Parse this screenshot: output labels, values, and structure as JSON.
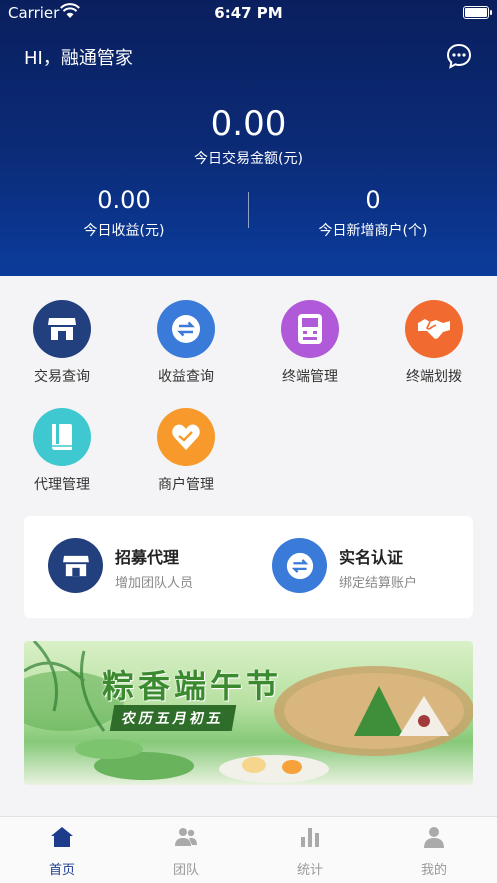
{
  "status_bar": {
    "carrier": "Carrier",
    "time": "6:47 PM"
  },
  "header": {
    "greeting": "HI，融通管家",
    "today_amount": "0.00",
    "today_amount_label": "今日交易金额(元)",
    "today_income": "0.00",
    "today_income_label": "今日收益(元)",
    "new_merchants": "0",
    "new_merchants_label": "今日新增商户(个)"
  },
  "menu": [
    {
      "label": "交易查询",
      "icon": "store-icon",
      "color": "#23407e"
    },
    {
      "label": "收益查询",
      "icon": "exchange-icon",
      "color": "#3a7ad8"
    },
    {
      "label": "终端管理",
      "icon": "pos-terminal-icon",
      "color": "#b15ad9"
    },
    {
      "label": "终端划拨",
      "icon": "handshake-icon",
      "color": "#f16a2f"
    },
    {
      "label": "代理管理",
      "icon": "book-icon",
      "color": "#3fc8cf"
    },
    {
      "label": "商户管理",
      "icon": "heart-icon",
      "color": "#f79a2b"
    }
  ],
  "cards": [
    {
      "title": "招募代理",
      "subtitle": "增加团队人员",
      "icon": "store-icon",
      "color": "#23407e"
    },
    {
      "title": "实名认证",
      "subtitle": "绑定结算账户",
      "icon": "exchange-icon",
      "color": "#3a7ad8"
    }
  ],
  "banner": {
    "title": "粽香端午节",
    "subtitle": "农历五月初五"
  },
  "tabbar": [
    {
      "label": "首页",
      "icon": "home-icon",
      "active": true
    },
    {
      "label": "团队",
      "icon": "team-icon",
      "active": false
    },
    {
      "label": "统计",
      "icon": "stats-icon",
      "active": false
    },
    {
      "label": "我的",
      "icon": "profile-icon",
      "active": false
    }
  ],
  "colors": {
    "header_top": "#0a1f5e",
    "header_bottom": "#0b3c9c",
    "tab_active": "#1d3c8c",
    "tab_inactive": "#999999"
  }
}
